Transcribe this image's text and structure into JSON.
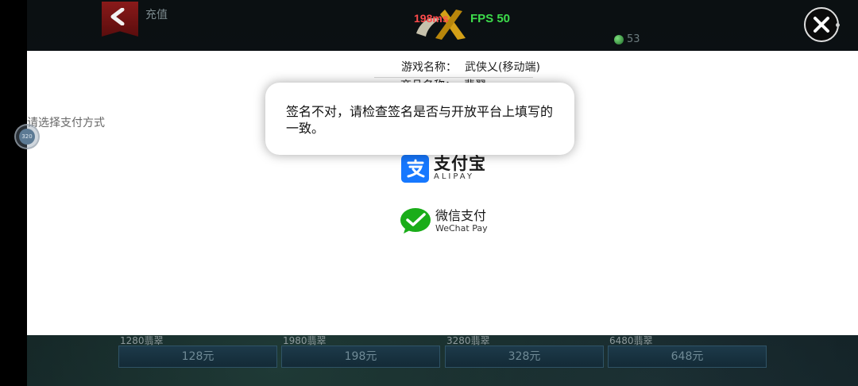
{
  "header": {
    "title": "充值",
    "ping": "198ms",
    "fps": "FPS 50",
    "currency_amount": "53"
  },
  "products": [
    {
      "name": "1280翡翠",
      "price": "128元"
    },
    {
      "name": "1980翡翠",
      "price": "198元"
    },
    {
      "name": "3280翡翠",
      "price": "328元"
    },
    {
      "name": "6480翡翠",
      "price": "648元"
    }
  ],
  "payment": {
    "game_name_label": "游戏名称：",
    "game_name_value": "武侠乂(移动端)",
    "product_name_label": "商品名称：",
    "product_name_value": "翡翠",
    "choose_method": "请选择支付方式",
    "alipay_cn": "支付宝",
    "alipay_en": "ALIPAY",
    "wechat_cn": "微信支付",
    "wechat_en": "WeChat Pay"
  },
  "float_widget_text": "320",
  "toast": {
    "message": "签名不对，请检查签名是否与开放平台上填写的一致。"
  },
  "colors": {
    "alipay_blue": "#1678ff",
    "wechat_green": "#1aad19",
    "fps_green": "#3ddc4b",
    "ping_red": "#ff4b4b"
  }
}
